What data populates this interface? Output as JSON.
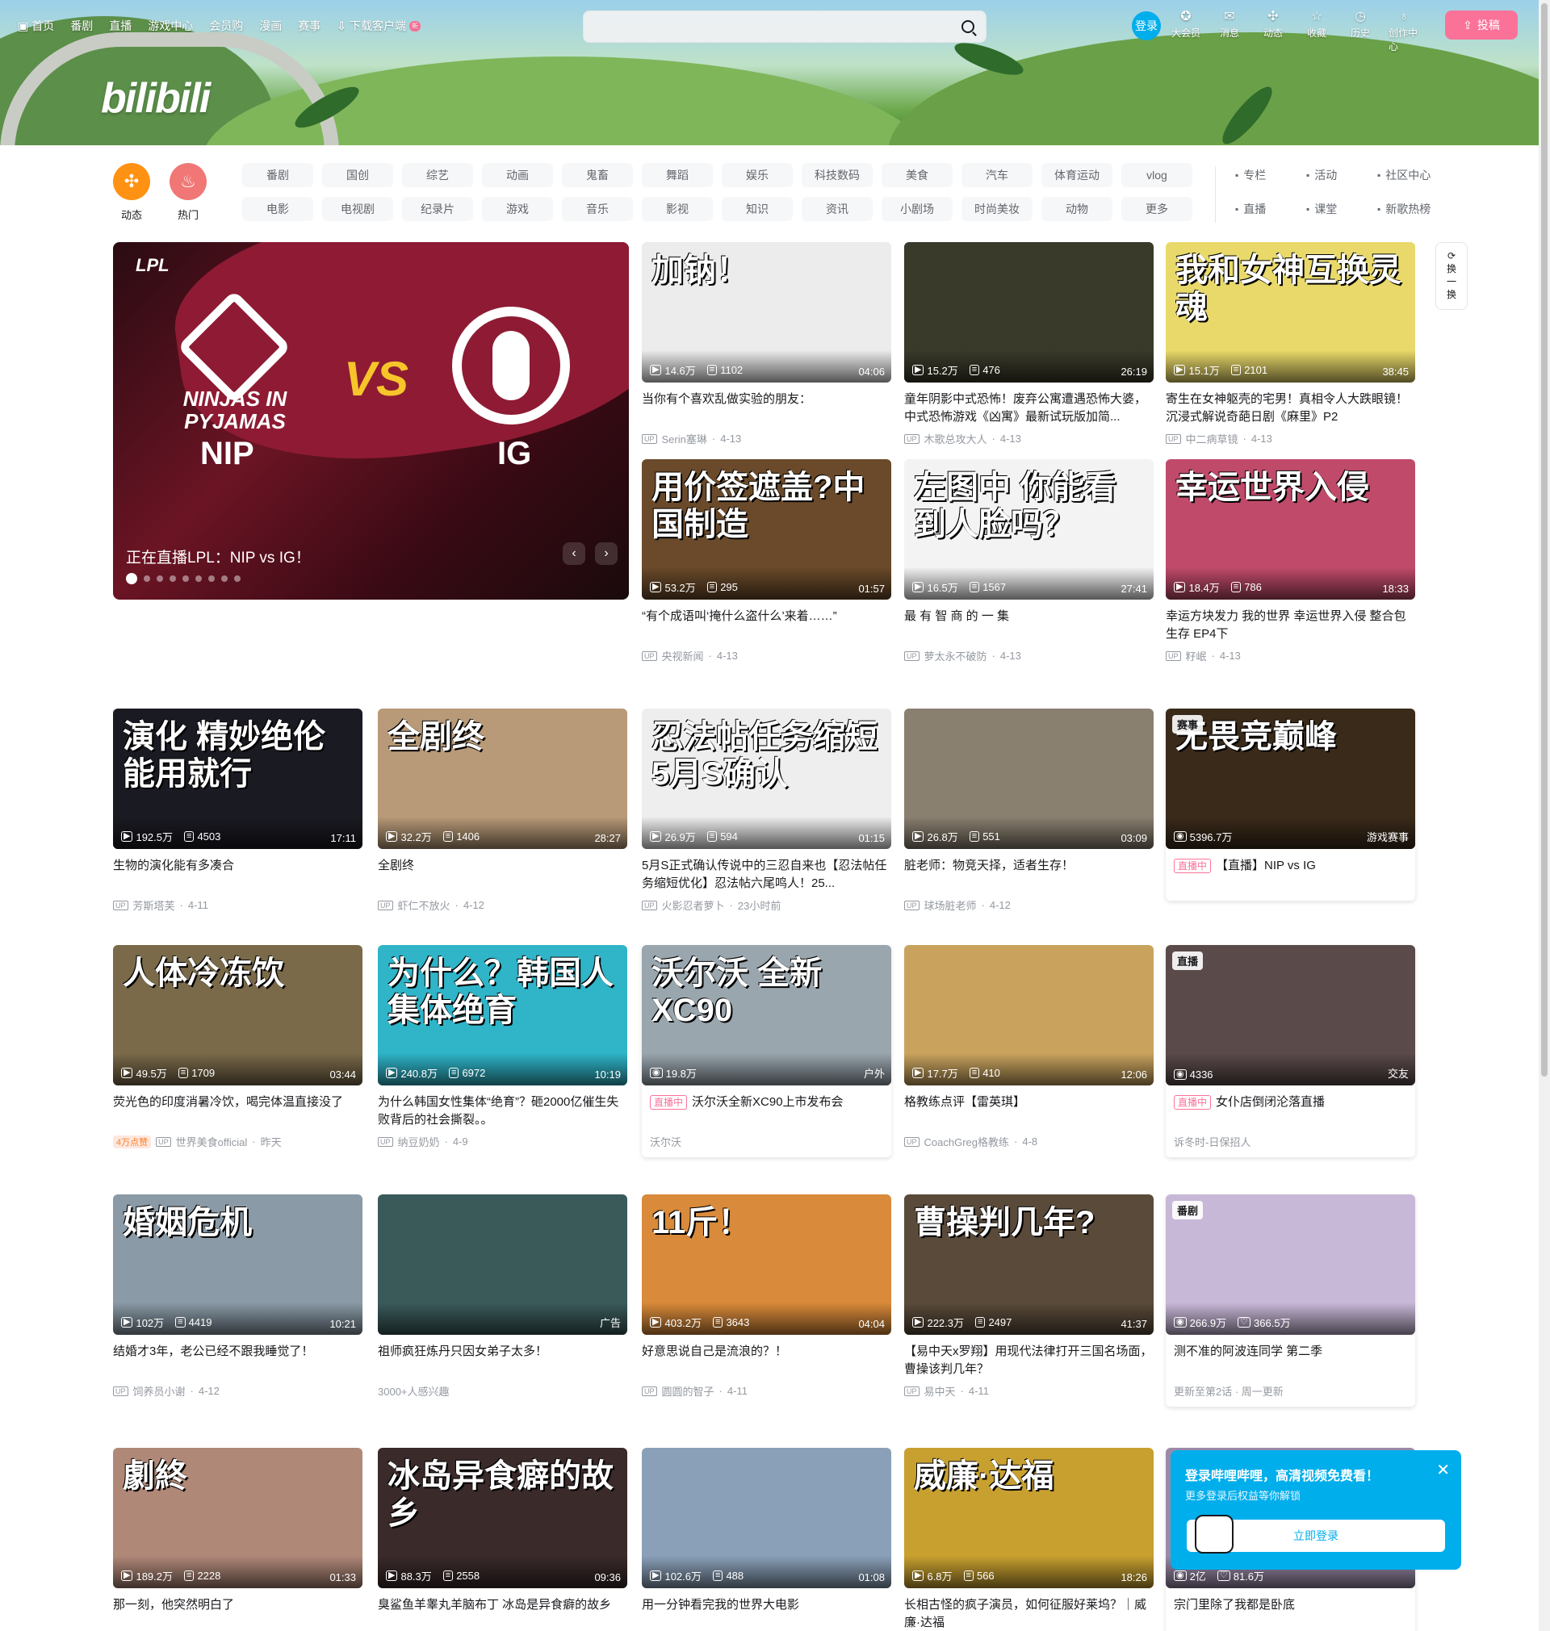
{
  "nav": {
    "items": [
      "首页",
      "番剧",
      "直播",
      "游戏中心",
      "会员购",
      "漫画",
      "赛事",
      "下载客户端"
    ],
    "new_badge": "新"
  },
  "search": {
    "placeholder": ""
  },
  "logo": "bilibili",
  "user": {
    "login": "登录",
    "items": [
      {
        "icon": "vip-icon",
        "label": "大会员"
      },
      {
        "icon": "message-icon",
        "label": "消息"
      },
      {
        "icon": "dynamic-icon",
        "label": "动态"
      },
      {
        "icon": "favorite-icon",
        "label": "收藏"
      },
      {
        "icon": "history-icon",
        "label": "历史"
      },
      {
        "icon": "creation-icon",
        "label": "创作中心"
      }
    ],
    "upload": "投稿"
  },
  "channels": {
    "dynamic": "动态",
    "hot": "热门",
    "grid": [
      "番剧",
      "国创",
      "综艺",
      "动画",
      "鬼畜",
      "舞蹈",
      "娱乐",
      "科技数码",
      "美食",
      "汽车",
      "体育运动",
      "vlog",
      "电影",
      "电视剧",
      "纪录片",
      "游戏",
      "音乐",
      "影视",
      "知识",
      "资讯",
      "小剧场",
      "时尚美妆",
      "动物",
      "更多"
    ],
    "right": [
      {
        "icon": "article-icon",
        "label": "专栏"
      },
      {
        "icon": "activity-icon",
        "label": "活动"
      },
      {
        "icon": "community-icon",
        "label": "社区中心"
      },
      {
        "icon": "live-icon",
        "label": "直播"
      },
      {
        "icon": "class-icon",
        "label": "课堂"
      },
      {
        "icon": "music-icon",
        "label": "新歌热榜"
      }
    ]
  },
  "carousel": {
    "brand": "LPL",
    "team1": "NIP",
    "team1_full": "NINJAS IN PYJAMAS",
    "vs": "VS",
    "team2": "IG",
    "title": "正在直播LPL：NIP vs IG！",
    "dots": 9,
    "active": 0
  },
  "refresh": [
    "换",
    "一",
    "换"
  ],
  "videos": [
    {
      "thumb_text": "加钠！",
      "bg": "#ececec",
      "views": "14.6万",
      "danmaku": "1102",
      "dur": "04:06",
      "title": "当你有个喜欢乱做实验的朋友：",
      "up": "Serin塞琳",
      "date": "4-13"
    },
    {
      "thumb_text": "",
      "bg": "#3a3a2a",
      "views": "15.2万",
      "danmaku": "476",
      "dur": "26:19",
      "title": "童年阴影中式恐怖！废弃公寓遭遇恐怖大婆，中式恐怖游戏《凶寓》最新试玩版加简...",
      "up": "木歌总攻大人",
      "date": "4-13"
    },
    {
      "thumb_text": "我和女神互换灵魂",
      "bg": "#e9d96a",
      "views": "15.1万",
      "danmaku": "2101",
      "dur": "38:45",
      "title": "寄生在女神躯壳的宅男！真相令人大跌眼镜！沉浸式解说奇葩日剧《麻里》P2",
      "up": "中二病草镜",
      "date": "4-13"
    },
    {
      "thumb_text": "用价签遮盖?中国制造",
      "bg": "#6a4a2a",
      "views": "53.2万",
      "danmaku": "295",
      "dur": "01:57",
      "title": "“有个成语叫‘掩什么盗什么’来着……”",
      "up": "央视新闻",
      "date": "4-13"
    },
    {
      "thumb_text": "左图中 你能看到人脸吗？",
      "bg": "#f3f3f3",
      "views": "16.5万",
      "danmaku": "1567",
      "dur": "27:41",
      "title": "最 有 智 商 的 一 集",
      "up": "萝太永不破防",
      "date": "4-13"
    },
    {
      "thumb_text": "幸运世界入侵",
      "bg": "#c04a6a",
      "views": "18.4万",
      "danmaku": "786",
      "dur": "18:33",
      "title": "幸运方块发力 我的世界 幸运世界入侵 整合包生存 EP4下",
      "up": "籽岷",
      "date": "4-13"
    },
    {
      "thumb_text": "演化 精妙绝伦 能用就行",
      "bg": "#1a1a22",
      "views": "192.5万",
      "danmaku": "4503",
      "dur": "17:11",
      "title": "生物的演化能有多凑合",
      "up": "芳斯塔芙",
      "date": "4-11"
    },
    {
      "thumb_text": "全剧终",
      "bg": "#b89a78",
      "views": "32.2万",
      "danmaku": "1406",
      "dur": "28:27",
      "title": "全剧终",
      "up": "虾仁不放火",
      "date": "4-12"
    },
    {
      "thumb_text": "忍法帖任务缩短 5月S确认",
      "bg": "#eeeeee",
      "views": "26.9万",
      "danmaku": "594",
      "dur": "01:15",
      "title": "5月S正式确认传说中的三忍自来也【忍法帖任务缩短优化】忍法帖六尾鸣人！25...",
      "up": "火影忍者萝卜",
      "date": "23小时前"
    },
    {
      "thumb_text": "",
      "bg": "#8a8070",
      "views": "26.8万",
      "danmaku": "551",
      "dur": "03:09",
      "title": "脏老师：物竞天择，适者生存！",
      "up": "球场脏老师",
      "date": "4-12"
    },
    {
      "thumb_text": "人体冷冻饮",
      "bg": "#7a6a4a",
      "views": "49.5万",
      "danmaku": "1709",
      "dur": "03:44",
      "title": "荧光色的印度消暑冷饮，喝完体温直接没了",
      "up": "世界美食official",
      "date": "昨天",
      "hot": "4万点赞"
    },
    {
      "thumb_text": "为什么？韩国人集体绝育",
      "bg": "#2fb4c8",
      "views": "240.8万",
      "danmaku": "6972",
      "dur": "10:19",
      "title": "为什么韩国女性集体“绝育”？砸2000亿催生失败背后的社会撕裂。。",
      "up": "纳豆奶奶",
      "date": "4-9"
    },
    {
      "thumb_text": "",
      "bg": "#c9a35e",
      "views": "17.7万",
      "danmaku": "410",
      "dur": "12:06",
      "title": "格教练点评【雷英琪】",
      "up": "CoachGreg格教练",
      "date": "4-8"
    },
    {
      "thumb_text": "婚姻危机",
      "bg": "#8a9aa6",
      "views": "102万",
      "danmaku": "4419",
      "dur": "10:21",
      "title": "结婚才3年，老公已经不跟我睡觉了！",
      "up": "饲养员小谢",
      "date": "4-12"
    },
    {
      "thumb_text": "",
      "bg": "#3a5a5a",
      "views": "",
      "danmaku": "",
      "dur": "广告",
      "title": "祖师疯狂炼丹只因女弟子太多！",
      "up": "",
      "date": "",
      "info": "3000+人感兴趣"
    },
    {
      "thumb_text": "11斤！",
      "bg": "#d98a3a",
      "views": "403.2万",
      "danmaku": "3643",
      "dur": "04:04",
      "title": "好意思说自己是流浪的？！",
      "up": "圆圆的智子",
      "date": "4-11"
    },
    {
      "thumb_text": "曹操判几年?",
      "bg": "#5a4a3a",
      "views": "222.3万",
      "danmaku": "2497",
      "dur": "41:37",
      "title": "【易中天x罗翔】用现代法律打开三国名场面，曹操该判几年？",
      "up": "易中天",
      "date": "4-11"
    },
    {
      "thumb_text": "劇終",
      "bg": "#b08878",
      "views": "189.2万",
      "danmaku": "2228",
      "dur": "01:33",
      "title": "那一刻，他突然明白了",
      "up": "",
      "date": ""
    },
    {
      "thumb_text": "冰岛异食癖的故乡",
      "bg": "#3a2a2a",
      "views": "88.3万",
      "danmaku": "2558",
      "dur": "09:36",
      "title": "臭鲨鱼羊睾丸羊脑布丁 冰岛是异食癖的故乡",
      "up": "",
      "date": ""
    },
    {
      "thumb_text": "",
      "bg": "#8aa0b8",
      "views": "102.6万",
      "danmaku": "488",
      "dur": "01:08",
      "title": "用一分钟看完我的世界大电影",
      "up": "",
      "date": ""
    },
    {
      "thumb_text": "威廉·达福",
      "bg": "#c8a030",
      "views": "6.8万",
      "danmaku": "566",
      "dur": "18:26",
      "title": "长相古怪的疯子演员，如何征服好莱坞？｜威廉·达福",
      "up": "",
      "date": ""
    }
  ],
  "specials": [
    {
      "tag": "赛事",
      "views": "5396.7万",
      "right": "游戏赛事",
      "live": "直播中",
      "title": "【直播】NIP vs IG",
      "bg": "#3a2a1a",
      "thumb_text": "无畏竞巅峰"
    },
    {
      "views": "19.8万",
      "right": "户外",
      "live": "直播中",
      "title": "沃尔沃全新XC90上市发布会",
      "up": "沃尔沃",
      "bg": "#9aa6ae",
      "thumb_text": "沃尔沃 全新XC90"
    },
    {
      "tag": "直播",
      "views": "4336",
      "right": "交友",
      "live": "直播中",
      "title": "女仆店倒闭沦落直播",
      "up": "诉冬时-日保招人",
      "bg": "#5a4a4a",
      "thumb_text": ""
    },
    {
      "tag": "番剧",
      "views": "266.9万",
      "likes": "366.5万",
      "title": "测不准的阿波连同学 第二季",
      "up": "更新至第2话 · 周一更新",
      "bg": "#c8b8d8",
      "thumb_text": ""
    },
    {
      "views": "2亿",
      "likes": "81.6万",
      "title": "宗门里除了我都是卧底",
      "bg": "#9a8aa8",
      "thumb_text": ""
    }
  ],
  "popup": {
    "title": "登录哔哩哔哩，高清视频免费看！",
    "sub": "更多登录后权益等你解锁",
    "button": "立即登录"
  }
}
